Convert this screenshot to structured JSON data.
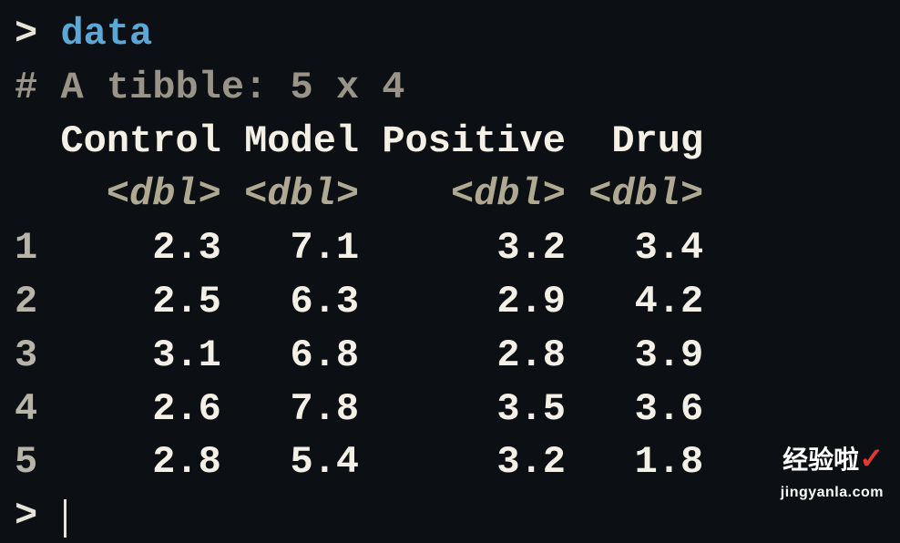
{
  "console": {
    "prompt_symbol": ">",
    "command": "data",
    "comment_prefix": "#",
    "tibble_label": "A tibble: 5 x 4",
    "type_annotation": "<dbl>",
    "columns": [
      "Control",
      "Model",
      "Positive",
      "Drug"
    ],
    "rows": [
      {
        "n": "1",
        "Control": "2.3",
        "Model": "7.1",
        "Positive": "3.2",
        "Drug": "3.4"
      },
      {
        "n": "2",
        "Control": "2.5",
        "Model": "6.3",
        "Positive": "2.9",
        "Drug": "4.2"
      },
      {
        "n": "3",
        "Control": "3.1",
        "Model": "6.8",
        "Positive": "2.8",
        "Drug": "3.9"
      },
      {
        "n": "4",
        "Control": "2.6",
        "Model": "7.8",
        "Positive": "3.5",
        "Drug": "3.6"
      },
      {
        "n": "5",
        "Control": "2.8",
        "Model": "5.4",
        "Positive": "3.2",
        "Drug": "1.8"
      }
    ]
  },
  "watermark": {
    "text_zh": "经验啦",
    "check": "✓",
    "domain": "jingyanla.com"
  },
  "chart_data": {
    "type": "table",
    "title": "A tibble: 5 x 4",
    "columns": [
      "Control",
      "Model",
      "Positive",
      "Drug"
    ],
    "column_types": [
      "dbl",
      "dbl",
      "dbl",
      "dbl"
    ],
    "data": [
      [
        2.3,
        7.1,
        3.2,
        3.4
      ],
      [
        2.5,
        6.3,
        2.9,
        4.2
      ],
      [
        3.1,
        6.8,
        2.8,
        3.9
      ],
      [
        2.6,
        7.8,
        3.5,
        3.6
      ],
      [
        2.8,
        5.4,
        3.2,
        1.8
      ]
    ]
  }
}
